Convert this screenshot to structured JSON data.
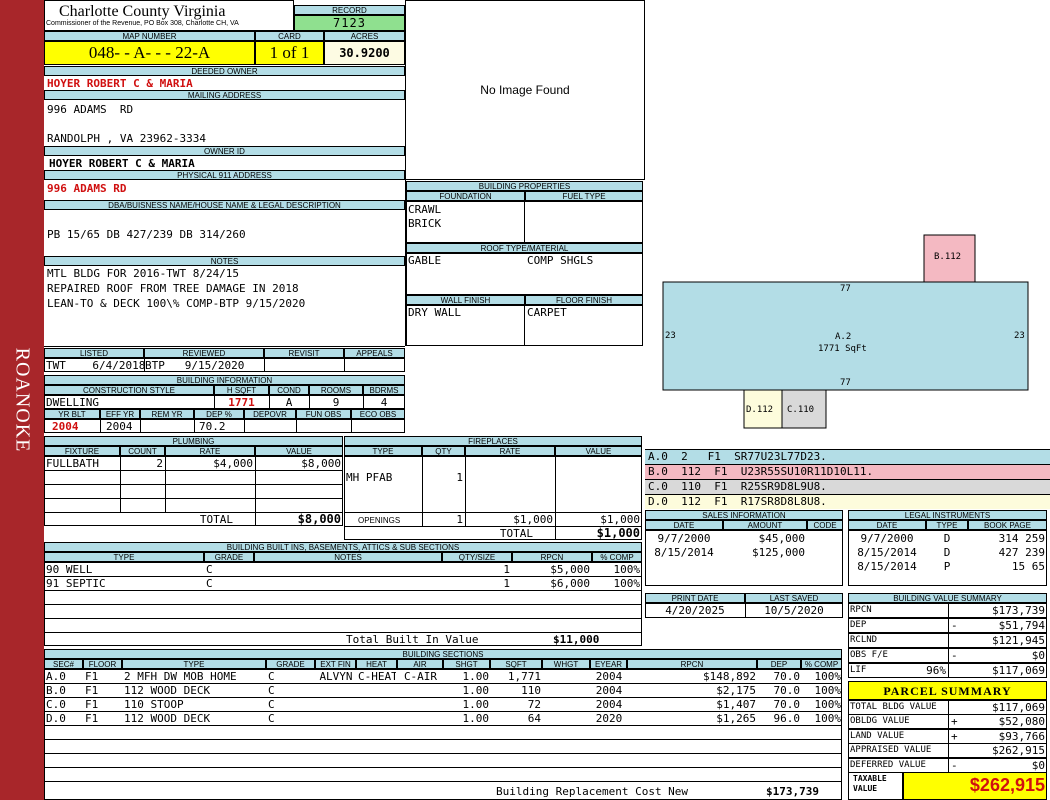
{
  "sidebar": {
    "label": "ROANOKE"
  },
  "header": {
    "county": "Charlotte County Virginia",
    "office": "Commissioner of the Revenue, PO Box 308, Charlotte CH, VA",
    "record_label": "RECORD",
    "record": "7123",
    "map_label": "MAP NUMBER",
    "map_number": "048- - A- - - 22-A",
    "card_label": "CARD",
    "card": "1 of 1",
    "acres_label": "ACRES",
    "acres": "30.9200"
  },
  "owner": {
    "deeded_label": "DEEDED OWNER",
    "deeded": "HOYER ROBERT C & MARIA",
    "mailing_label": "MAILING ADDRESS",
    "mail1": "996 ADAMS  RD",
    "mail2": "RANDOLPH , VA 23962-3334",
    "ownerid_label": "OWNER ID",
    "owner_id": "HOYER ROBERT C & MARIA",
    "phys_label": "PHYSICAL 911 ADDRESS",
    "phys": "996 ADAMS RD",
    "dba_label": "DBA/BUISNESS NAME/HOUSE NAME & LEGAL DESCRIPTION",
    "legal": "PB 15/65 DB 427/239 DB 314/260",
    "notes_label": "NOTES",
    "notes": [
      "MTL BLDG FOR 2016-TWT 8/24/15",
      "REPAIRED ROOF FROM TREE DAMAGE IN 2018",
      "LEAN-TO & DECK 100\\% COMP-BTP 9/15/2020"
    ]
  },
  "photo": {
    "text": "No Image Found"
  },
  "props": {
    "title": "BUILDING PROPERTIES",
    "foundation_label": "FOUNDATION",
    "fuel_label": "FUEL TYPE",
    "foundation1": "CRAWL",
    "foundation2": "BRICK",
    "roof_label": "ROOF TYPE/MATERIAL",
    "roof_type": "GABLE",
    "roof_mat": "COMP SHGLS",
    "wall_label": "WALL FINISH",
    "floor_label": "FLOOR FINISH",
    "wall": "DRY WALL",
    "floor": "CARPET"
  },
  "review": {
    "listed_label": "LISTED",
    "reviewed_label": "REVIEWED",
    "revisit_label": "REVISIT",
    "appeals_label": "APPEALS",
    "listed": "TWT    6/4/2018",
    "reviewed": "BTP   9/15/2020"
  },
  "info": {
    "title": "BUILDING INFORMATION",
    "labels": {
      "style": "CONSTRUCTION STYLE",
      "hsqft": "H SQFT",
      "cond": "COND",
      "rooms": "ROOMS",
      "bdrms": "BDRMS",
      "yrblt": "YR BLT",
      "effyr": "EFF YR",
      "remyr": "REM YR",
      "dep": "DEP %",
      "depovr": "DEPOVR",
      "funobs": "FUN OBS",
      "ecoobs": "ECO OBS"
    },
    "style": "DWELLING",
    "hsqft": "1771",
    "cond": "A",
    "rooms": "9",
    "bdrms": "4",
    "yrblt": "2004",
    "effyr": "2004",
    "dep": "70.2"
  },
  "plumbing": {
    "title": "PLUMBING",
    "cols": [
      "FIXTURE",
      "COUNT",
      "RATE",
      "VALUE"
    ],
    "rows": [
      [
        "FULLBATH",
        "2",
        "$4,000",
        "$8,000"
      ]
    ],
    "total_label": "TOTAL",
    "total": "$8,000"
  },
  "fireplaces": {
    "title": "FIREPLACES",
    "cols": [
      "TYPE",
      "QTY",
      "RATE",
      "VALUE"
    ],
    "rows": [
      [
        "MH PFAB",
        "1",
        "",
        ""
      ]
    ],
    "openings_label": "OPENINGS",
    "openings": [
      "1",
      "$1,000",
      "$1,000"
    ],
    "total_label": "TOTAL",
    "total": "$1,000"
  },
  "builtins": {
    "title": "BUILDING BUILT INS, BASEMENTS, ATTICS & SUB SECTIONS",
    "cols": [
      "TYPE",
      "GRADE",
      "NOTES",
      "QTY/SIZE",
      "RPCN",
      "% COMP"
    ],
    "rows": [
      [
        "90 WELL",
        "C",
        "",
        "1",
        "$5,000",
        "100%"
      ],
      [
        "91 SEPTIC",
        "C",
        "",
        "1",
        "$6,000",
        "100%"
      ]
    ],
    "total_label": "Total Built In Value",
    "total": "$11,000"
  },
  "sketch": {
    "main": {
      "label": "A.2",
      "area": "1771 SqFt",
      "top": "77",
      "bottom": "77",
      "left": "23",
      "right": "23"
    },
    "b": "B.112",
    "d": "D.112",
    "c": "C.110",
    "legend": [
      {
        "code": "A.0  2   F1  SR77U23L77D23.",
        "color": "#b3dde6"
      },
      {
        "code": "B.0  112  F1  U23R55SU10R11D10L11.",
        "color": "#f4b9c2"
      },
      {
        "code": "C.0  110  F1  R25SR9D8L9U8.",
        "color": "#d9d9d9"
      },
      {
        "code": "D.0  112  F1  R17SR8D8L8U8.",
        "color": "#fdfcdc"
      }
    ]
  },
  "sales": {
    "title": "SALES INFORMATION",
    "cols": [
      "DATE",
      "AMOUNT",
      "CODE"
    ],
    "rows": [
      [
        "9/7/2000",
        "$45,000",
        ""
      ],
      [
        "8/15/2014",
        "$125,000",
        ""
      ]
    ]
  },
  "legal": {
    "title": "LEGAL INSTRUMENTS",
    "cols": [
      "DATE",
      "TYPE",
      "BOOK PAGE"
    ],
    "rows": [
      [
        "9/7/2000",
        "D",
        "314 259"
      ],
      [
        "8/15/2014",
        "D",
        "427 239"
      ],
      [
        "8/15/2014",
        "P",
        "15 65"
      ]
    ]
  },
  "dates": {
    "print_label": "PRINT DATE",
    "saved_label": "LAST SAVED",
    "print": "4/20/2025",
    "saved": "10/5/2020"
  },
  "bvs": {
    "title": "BUILDING VALUE SUMMARY",
    "rows": [
      {
        "label": "RPCN",
        "sign": "",
        "value": "$173,739"
      },
      {
        "label": "DEP",
        "sign": "-",
        "value": "$51,794"
      },
      {
        "label": "RCLND",
        "sign": "",
        "value": "$121,945"
      },
      {
        "label": "OBS F/E",
        "sign": "-",
        "value": "$0"
      },
      {
        "label": "LIF",
        "pct": "96%",
        "sign": "",
        "value": "$117,069"
      }
    ]
  },
  "parcel": {
    "title": "PARCEL SUMMARY",
    "rows": [
      {
        "label": "TOTAL BLDG VALUE",
        "sign": "",
        "value": "$117,069"
      },
      {
        "label": "OBLDG VALUE",
        "sign": "+",
        "value": "$52,080"
      },
      {
        "label": "LAND VALUE",
        "sign": "+",
        "value": "$93,766"
      },
      {
        "label": "APPRAISED VALUE",
        "sign": "",
        "value": "$262,915"
      },
      {
        "label": "DEFERRED VALUE",
        "sign": "-",
        "value": "$0"
      }
    ],
    "taxable_label1": "TAXABLE",
    "taxable_label2": "VALUE",
    "taxable": "$262,915"
  },
  "sections": {
    "title": "BUILDING SECTIONS",
    "cols": [
      "SEC#",
      "FLOOR",
      "TYPE",
      "GRADE",
      "EXT FIN",
      "HEAT",
      "AIR",
      "SHGT",
      "SQFT",
      "WHGT",
      "EYEAR",
      "RPCN",
      "DEP",
      "% COMP"
    ],
    "rows": [
      [
        "A.0",
        "F1",
        "2 MFH DW MOB HOME",
        "C",
        "ALVYN",
        "C-HEAT",
        "C-AIR",
        "1.00",
        "1,771",
        "",
        "2004",
        "$148,892",
        "70.0",
        "100%"
      ],
      [
        "B.0",
        "F1",
        "112 WOOD DECK",
        "C",
        "",
        "",
        "",
        "1.00",
        "110",
        "",
        "2004",
        "$2,175",
        "70.0",
        "100%"
      ],
      [
        "C.0",
        "F1",
        "110 STOOP",
        "C",
        "",
        "",
        "",
        "1.00",
        "72",
        "",
        "2004",
        "$1,407",
        "70.0",
        "100%"
      ],
      [
        "D.0",
        "F1",
        "112 WOOD DECK",
        "C",
        "",
        "",
        "",
        "1.00",
        "64",
        "",
        "2020",
        "$1,265",
        "96.0",
        "100%"
      ]
    ],
    "rcn_label": "Building Replacement Cost New",
    "rcn": "$173,739"
  }
}
